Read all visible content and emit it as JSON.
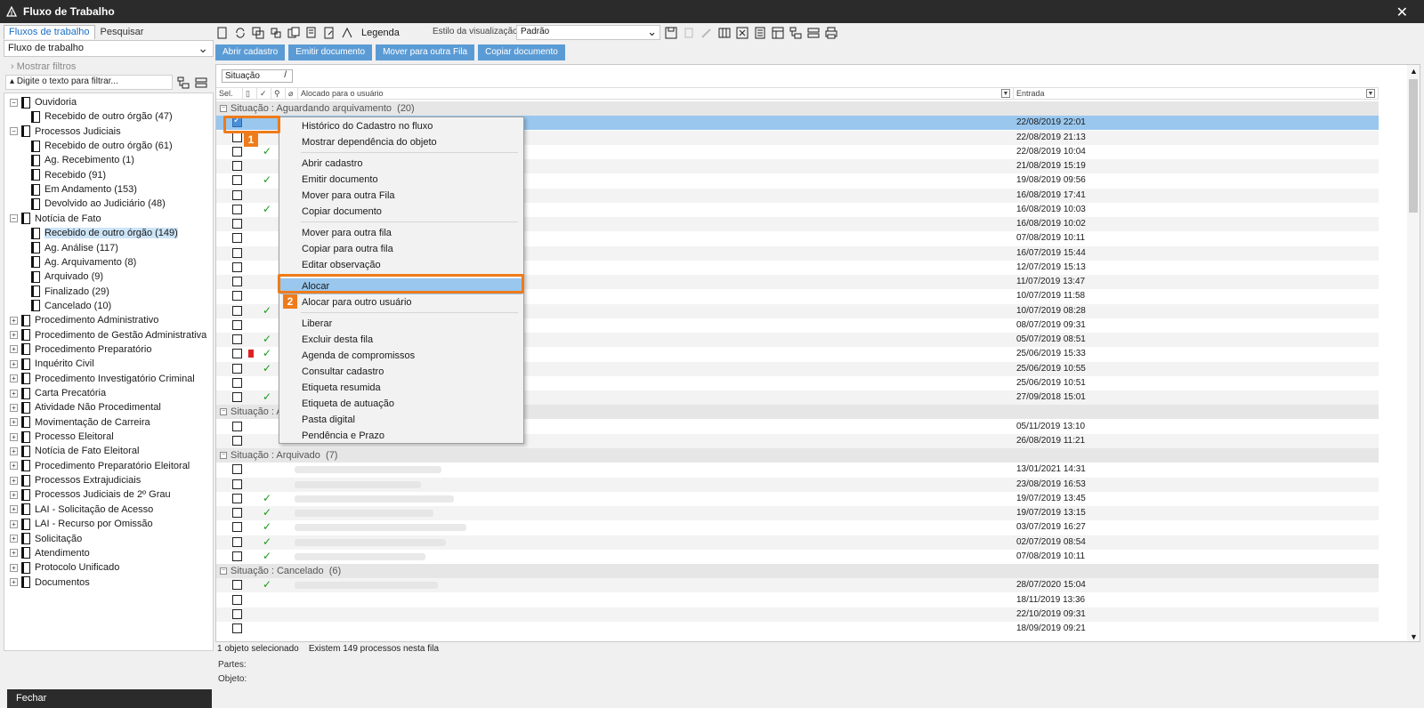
{
  "window": {
    "title": "Fluxo de Trabalho",
    "close": "✕"
  },
  "left": {
    "tabs": [
      "Fluxos de trabalho",
      "Pesquisar"
    ],
    "flow_select": "Fluxo de trabalho",
    "show_filters": "Mostrar filtros",
    "filter_placeholder": "Digite o texto para filtrar...",
    "tree": [
      {
        "label": "Ouvidoria",
        "level": 0,
        "exp": "−"
      },
      {
        "label": "Recebido de outro órgão (47)",
        "level": 1
      },
      {
        "label": "Processos Judiciais",
        "level": 0,
        "exp": "−"
      },
      {
        "label": "Recebido de outro órgão (61)",
        "level": 1
      },
      {
        "label": "Ag. Recebimento (1)",
        "level": 1
      },
      {
        "label": "Recebido (91)",
        "level": 1
      },
      {
        "label": "Em Andamento (153)",
        "level": 1
      },
      {
        "label": "Devolvido ao Judiciário (48)",
        "level": 1
      },
      {
        "label": "Notícia de Fato",
        "level": 0,
        "exp": "−"
      },
      {
        "label": "Recebido de outro órgão (149)",
        "level": 1,
        "selected": true
      },
      {
        "label": "Ag. Análise (117)",
        "level": 1
      },
      {
        "label": "Ag. Arquivamento (8)",
        "level": 1
      },
      {
        "label": "Arquivado (9)",
        "level": 1
      },
      {
        "label": "Finalizado (29)",
        "level": 1
      },
      {
        "label": "Cancelado (10)",
        "level": 1
      },
      {
        "label": "Procedimento Administrativo",
        "level": 0,
        "exp": "+"
      },
      {
        "label": "Procedimento de Gestão Administrativa",
        "level": 0,
        "exp": "+"
      },
      {
        "label": "Procedimento Preparatório",
        "level": 0,
        "exp": "+"
      },
      {
        "label": "Inquérito Civil",
        "level": 0,
        "exp": "+"
      },
      {
        "label": "Procedimento Investigatório Criminal",
        "level": 0,
        "exp": "+"
      },
      {
        "label": "Carta Precatória",
        "level": 0,
        "exp": "+"
      },
      {
        "label": "Atividade Não Procedimental",
        "level": 0,
        "exp": "+"
      },
      {
        "label": "Movimentação de Carreira",
        "level": 0,
        "exp": "+"
      },
      {
        "label": "Processo Eleitoral",
        "level": 0,
        "exp": "+"
      },
      {
        "label": "Notícia de Fato Eleitoral",
        "level": 0,
        "exp": "+"
      },
      {
        "label": "Procedimento Preparatório Eleitoral",
        "level": 0,
        "exp": "+"
      },
      {
        "label": "Processos Extrajudiciais",
        "level": 0,
        "exp": "+"
      },
      {
        "label": "Processos Judiciais de 2º Grau",
        "level": 0,
        "exp": "+"
      },
      {
        "label": "LAI - Solicitação de Acesso",
        "level": 0,
        "exp": "+"
      },
      {
        "label": "LAI - Recurso por Omissão",
        "level": 0,
        "exp": "+"
      },
      {
        "label": "Solicitação",
        "level": 0,
        "exp": "+"
      },
      {
        "label": "Atendimento",
        "level": 0,
        "exp": "+"
      },
      {
        "label": "Protocolo Unificado",
        "level": 0,
        "exp": "+"
      },
      {
        "label": "Documentos",
        "level": 0,
        "exp": "+"
      }
    ],
    "close_button": "Fechar"
  },
  "toolbar": {
    "legend": "Legenda",
    "view_style_label": "Estilo da visualização",
    "view_style_value": "Padrão"
  },
  "actions": [
    "Abrir cadastro",
    "Emitir documento",
    "Mover para outra Fila",
    "Copiar documento"
  ],
  "grid": {
    "group_box": "Situação",
    "columns": {
      "sel": "Sel.",
      "alloc": "Alocado para o usuário",
      "entry": "Entrada"
    },
    "rows": [
      {
        "type": "group",
        "label": "Situação : Aguardando arquivamento",
        "count": "(20)"
      },
      {
        "date": "22/08/2019 22:01",
        "checked": true,
        "highlight": true
      },
      {
        "date": "22/08/2019 21:13"
      },
      {
        "date": "22/08/2019 10:04",
        "ok": true
      },
      {
        "date": "21/08/2019 15:19"
      },
      {
        "date": "19/08/2019 09:56",
        "ok": true
      },
      {
        "date": "16/08/2019 17:41"
      },
      {
        "date": "16/08/2019 10:03",
        "ok": true
      },
      {
        "date": "16/08/2019 10:02"
      },
      {
        "date": "07/08/2019 10:11"
      },
      {
        "date": "16/07/2019 15:44"
      },
      {
        "date": "12/07/2019 15:13"
      },
      {
        "date": "11/07/2019 13:47"
      },
      {
        "date": "10/07/2019 11:58"
      },
      {
        "date": "10/07/2019 08:28",
        "ok": true
      },
      {
        "date": "08/07/2019 09:31"
      },
      {
        "date": "05/07/2019 08:51",
        "ok": true
      },
      {
        "date": "25/06/2019 15:33",
        "ok": true,
        "flag": true
      },
      {
        "date": "25/06/2019 10:55",
        "ok": true
      },
      {
        "date": "25/06/2019 10:51"
      },
      {
        "date": "27/09/2018 15:01",
        "ok": true
      },
      {
        "type": "group",
        "label": "Situação : A",
        "count": ""
      },
      {
        "date": "05/11/2019 13:10"
      },
      {
        "date": "26/08/2019 11:21"
      },
      {
        "type": "group",
        "label": "Situação : Arquivado",
        "count": "(7)"
      },
      {
        "date": "13/01/2021 14:31",
        "blur": true
      },
      {
        "date": "23/08/2019 16:53",
        "blur": true
      },
      {
        "date": "19/07/2019 13:45",
        "ok": true,
        "blur": true
      },
      {
        "date": "19/07/2019 13:15",
        "ok": true,
        "blur": true
      },
      {
        "date": "03/07/2019 16:27",
        "ok": true,
        "blur": true
      },
      {
        "date": "02/07/2019 08:54",
        "ok": true,
        "blur": true
      },
      {
        "date": "07/08/2019 10:11",
        "ok": true,
        "blur": true
      },
      {
        "type": "group",
        "label": "Situação : Cancelado",
        "count": "(6)"
      },
      {
        "date": "28/07/2020 15:04",
        "ok": true,
        "blur": true
      },
      {
        "date": "18/11/2019 13:36"
      },
      {
        "date": "22/10/2019 09:31"
      },
      {
        "date": "18/09/2019 09:21"
      }
    ]
  },
  "status": {
    "selected": "1 objeto selecionado",
    "total": "Existem 149 processos nesta fila",
    "partes": "Partes:",
    "objeto": "Objeto:"
  },
  "context_menu": {
    "items": [
      {
        "label": "Histórico do Cadastro no fluxo"
      },
      {
        "label": "Mostrar dependência do objeto"
      },
      {
        "sep": true
      },
      {
        "label": "Abrir cadastro"
      },
      {
        "label": "Emitir documento"
      },
      {
        "label": "Mover para outra Fila"
      },
      {
        "label": "Copiar documento"
      },
      {
        "sep": true
      },
      {
        "label": "Mover para outra fila"
      },
      {
        "label": "Copiar para outra fila"
      },
      {
        "label": "Editar observação"
      },
      {
        "sep": true
      },
      {
        "label": "Alocar",
        "highlight": true
      },
      {
        "label": "Alocar para outro usuário"
      },
      {
        "sep": true
      },
      {
        "label": "Liberar"
      },
      {
        "label": "Excluir desta fila"
      },
      {
        "label": "Agenda de compromissos"
      },
      {
        "label": "Consultar cadastro"
      },
      {
        "label": "Etiqueta resumida"
      },
      {
        "label": "Etiqueta de autuação"
      },
      {
        "label": "Pasta digital"
      },
      {
        "label": "Pendência e Prazo"
      }
    ]
  },
  "annotations": [
    "1",
    "2"
  ],
  "colors": {
    "accent": "#5b9bd5",
    "highlight": "#99c7ee",
    "callout": "#ef7b1a",
    "check": "#1a9a1a",
    "flag": "#e02020"
  }
}
